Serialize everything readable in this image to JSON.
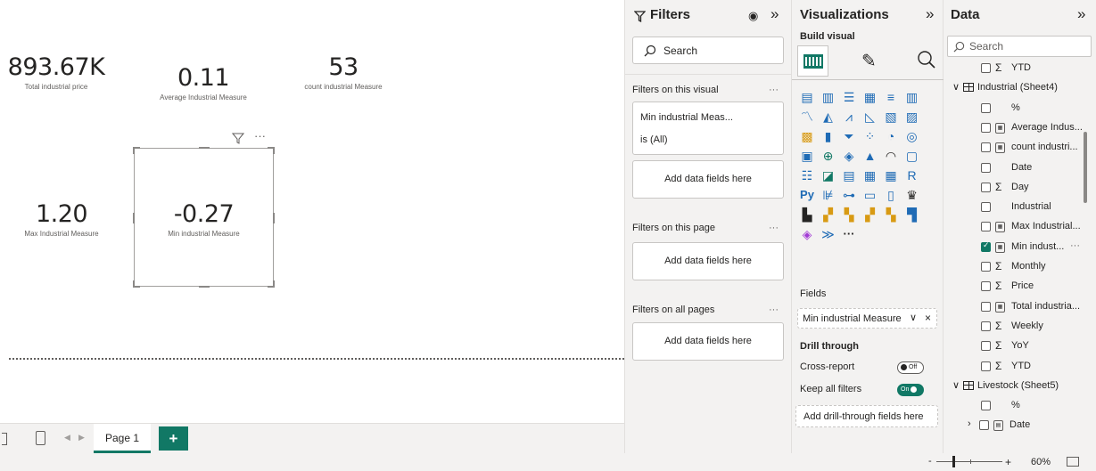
{
  "cards": {
    "total_price": {
      "value": "893.67K",
      "label": "Total industrial price"
    },
    "avg_measure": {
      "value": "0.11",
      "label": "Average Industrial Measure"
    },
    "count_measure": {
      "value": "53",
      "label": "count industrial Measure"
    },
    "max_measure": {
      "value": "1.20",
      "label": "Max Industrial Measure"
    },
    "min_measure": {
      "value": "-0.27",
      "label": "Min industrial Measure"
    }
  },
  "visual_header": {
    "filter_icon": "filter-icon",
    "more_icon": "more-options-icon",
    "more_label": "···"
  },
  "pages": {
    "current": "Page 1",
    "add_label": "+"
  },
  "zoom": {
    "minus": "-",
    "plus": "+",
    "level": "60%",
    "level_value": 60
  },
  "filters": {
    "title": "Filters",
    "search_placeholder": "Search",
    "on_visual": "Filters on this visual",
    "filter_card_title": "Min industrial Meas...",
    "filter_card_value": "is (All)",
    "add_fields": "Add data fields here",
    "on_page": "Filters on this page",
    "on_all_pages": "Filters on all pages",
    "more": "···",
    "expand": "»"
  },
  "visualizations": {
    "title": "Visualizations",
    "build_visual": "Build visual",
    "expand": "»",
    "more": "···",
    "r_label": "R",
    "py_label": "Py",
    "fields_label": "Fields",
    "field_value": "Min industrial Measure",
    "drill_through": "Drill through",
    "cross_report": "Cross-report",
    "cross_report_state": "Off",
    "keep_all_filters": "Keep all filters",
    "keep_all_state": "On",
    "add_drill": "Add drill-through fields here"
  },
  "data": {
    "title": "Data",
    "expand": "»",
    "search_placeholder": "Search",
    "items": [
      {
        "label": "YTD",
        "type": "sigma",
        "checked": false
      },
      {
        "label": "Industrial (Sheet4)",
        "type": "table",
        "checked": false
      },
      {
        "label": "%",
        "type": "plain",
        "checked": false
      },
      {
        "label": "Average Indus...",
        "type": "calc",
        "checked": false
      },
      {
        "label": "count industri...",
        "type": "calc",
        "checked": false
      },
      {
        "label": "Date",
        "type": "plain",
        "checked": false
      },
      {
        "label": "Day",
        "type": "sigma",
        "checked": false
      },
      {
        "label": "Industrial",
        "type": "plain",
        "checked": false
      },
      {
        "label": "Max Industrial...",
        "type": "calc",
        "checked": false
      },
      {
        "label": "Min indust...",
        "type": "calc",
        "checked": true
      },
      {
        "label": "Monthly",
        "type": "sigma",
        "checked": false
      },
      {
        "label": "Price",
        "type": "sigma",
        "checked": false
      },
      {
        "label": "Total industria...",
        "type": "calc",
        "checked": false
      },
      {
        "label": "Weekly",
        "type": "sigma",
        "checked": false
      },
      {
        "label": "YoY",
        "type": "sigma",
        "checked": false
      },
      {
        "label": "YTD",
        "type": "sigma",
        "checked": false
      },
      {
        "label": "Livestock (Sheet5)",
        "type": "table",
        "checked": false
      },
      {
        "label": "%",
        "type": "plain",
        "checked": false
      },
      {
        "label": "Date",
        "type": "date",
        "checked": false
      }
    ],
    "min_more": "···"
  }
}
